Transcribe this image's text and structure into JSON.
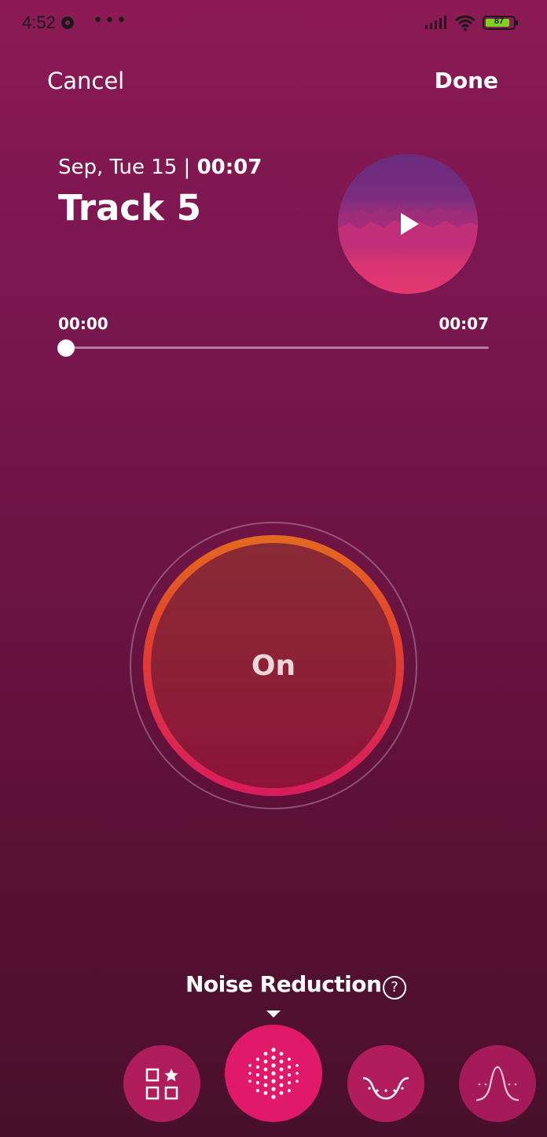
{
  "status_bar": {
    "time": "4:52",
    "dots": "•••",
    "battery": "87"
  },
  "header": {
    "cancel_label": "Cancel",
    "done_label": "Done"
  },
  "recording": {
    "date": "Sep, Tue 15 | ",
    "duration": "00:07",
    "title": "Track 5"
  },
  "player": {
    "current_time": "00:00",
    "total_time": "00:07",
    "progress": 0
  },
  "effect_toggle": {
    "label": "On"
  },
  "mode_selector": {
    "current_mode": "Noise Reduction",
    "help_label": "?",
    "modes": [
      {
        "icon": "favorites-grid-icon",
        "selected": false
      },
      {
        "icon": "noise-reduction-dots-icon",
        "selected": true
      },
      {
        "icon": "smile-curve-icon",
        "selected": false
      },
      {
        "icon": "peak-curve-icon",
        "selected": false
      }
    ]
  },
  "colors": {
    "accent": "#e0196a",
    "on_ring_top": "#e36a1f",
    "on_ring_bottom": "#d81c5e",
    "background_top": "#8c1a55",
    "background_bottom": "#48102b"
  }
}
